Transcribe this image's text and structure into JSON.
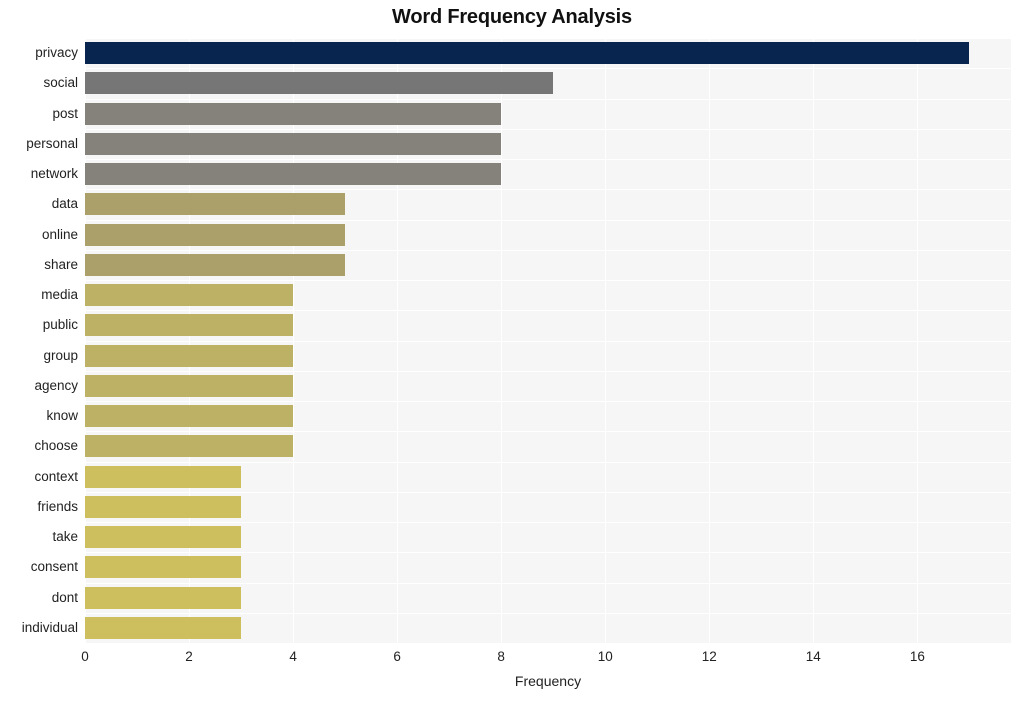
{
  "chart_data": {
    "type": "bar",
    "orientation": "horizontal",
    "title": "Word Frequency Analysis",
    "xlabel": "Frequency",
    "ylabel": "",
    "categories": [
      "privacy",
      "social",
      "post",
      "personal",
      "network",
      "data",
      "online",
      "share",
      "media",
      "public",
      "group",
      "agency",
      "know",
      "choose",
      "context",
      "friends",
      "take",
      "consent",
      "dont",
      "individual"
    ],
    "values": [
      17,
      9,
      8,
      8,
      8,
      5,
      5,
      5,
      4,
      4,
      4,
      4,
      4,
      4,
      3,
      3,
      3,
      3,
      3,
      3
    ],
    "bar_colors": [
      "#082550",
      "#767676",
      "#84827b",
      "#84827b",
      "#84827b",
      "#aba069",
      "#aba069",
      "#aba069",
      "#bcb164",
      "#bcb164",
      "#bcb164",
      "#bcb164",
      "#bcb164",
      "#bcb164",
      "#cdbf5e",
      "#cdbf5e",
      "#cdbf5e",
      "#cdbf5e",
      "#cdbf5e",
      "#cdbf5e"
    ],
    "xlim": [
      0,
      17.8
    ],
    "xticks": [
      0,
      2,
      4,
      6,
      8,
      10,
      12,
      14,
      16
    ],
    "xticklabels": [
      "0",
      "2",
      "4",
      "6",
      "8",
      "10",
      "12",
      "14",
      "16"
    ],
    "grid": true,
    "grid_color": "#ffffff",
    "plot_background": "#f6f6f6",
    "figure_background": "#ffffff",
    "legend": null
  }
}
